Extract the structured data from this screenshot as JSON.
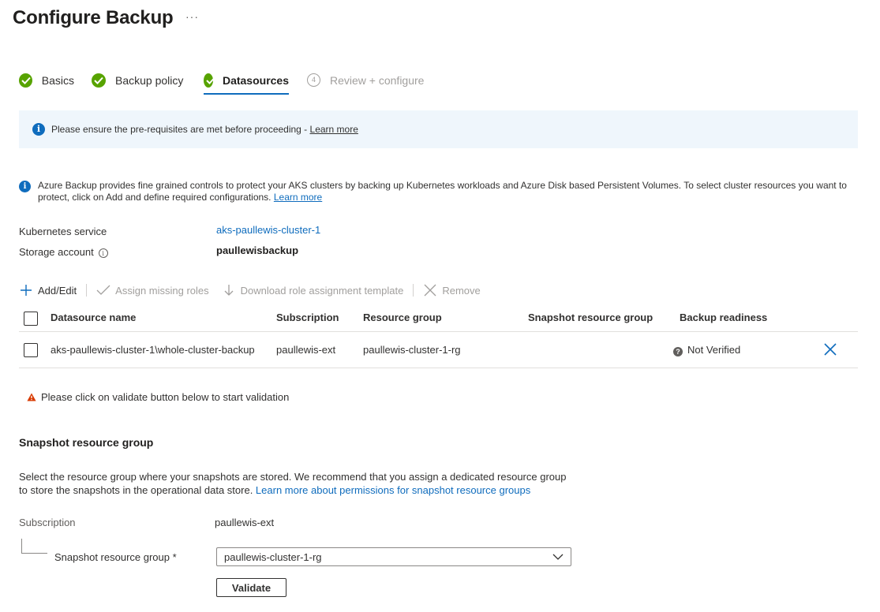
{
  "page": {
    "title": "Configure Backup",
    "more": "···"
  },
  "wizard": {
    "tabs": [
      {
        "label": "Basics",
        "state": "complete"
      },
      {
        "label": "Backup policy",
        "state": "complete"
      },
      {
        "label": "Datasources",
        "state": "active"
      },
      {
        "label": "Review + configure",
        "state": "pending",
        "number": "4"
      }
    ]
  },
  "banner": {
    "text": "Please ensure the pre-requisites are met before proceeding - ",
    "link": "Learn more"
  },
  "description": {
    "text": "Azure Backup provides fine grained controls to protect your AKS clusters by backing up Kubernetes workloads and Azure Disk based Persistent Volumes. To select cluster resources you want to protect, click on Add and define required configurations. ",
    "link": "Learn more"
  },
  "details": {
    "kubernetes_label": "Kubernetes service",
    "kubernetes_value": "aks-paullewis-cluster-1",
    "storage_label": "Storage account",
    "storage_value": "paullewisbackup"
  },
  "toolbar": {
    "add_edit": "Add/Edit",
    "assign_roles": "Assign missing roles",
    "download_template": "Download role assignment template",
    "remove": "Remove"
  },
  "table": {
    "columns": [
      "Datasource name",
      "Subscription",
      "Resource group",
      "Snapshot resource group",
      "Backup readiness"
    ],
    "rows": [
      {
        "datasource": "aks-paullewis-cluster-1\\whole-cluster-backup",
        "subscription": "paullewis-ext",
        "resource_group": "paullewis-cluster-1-rg",
        "snapshot_rg": "",
        "readiness": "Not Verified"
      }
    ]
  },
  "warning": {
    "text": "Please click on validate button below to start validation"
  },
  "snapshot_section": {
    "title": "Snapshot resource group",
    "desc": "Select the resource group where your snapshots are stored. We recommend that you assign a dedicated resource group to store the snapshots in the operational data store. ",
    "link": "Learn more about permissions for snapshot resource groups",
    "subscription_label": "Subscription",
    "subscription_value": "paullewis-ext",
    "rg_label": "Snapshot resource group *",
    "rg_value": "paullewis-cluster-1-rg",
    "validate_label": "Validate"
  },
  "colors": {
    "accent": "#0f6cbd",
    "success": "#57a300",
    "warning": "#d83b01",
    "banner_bg": "#eff6fc"
  }
}
